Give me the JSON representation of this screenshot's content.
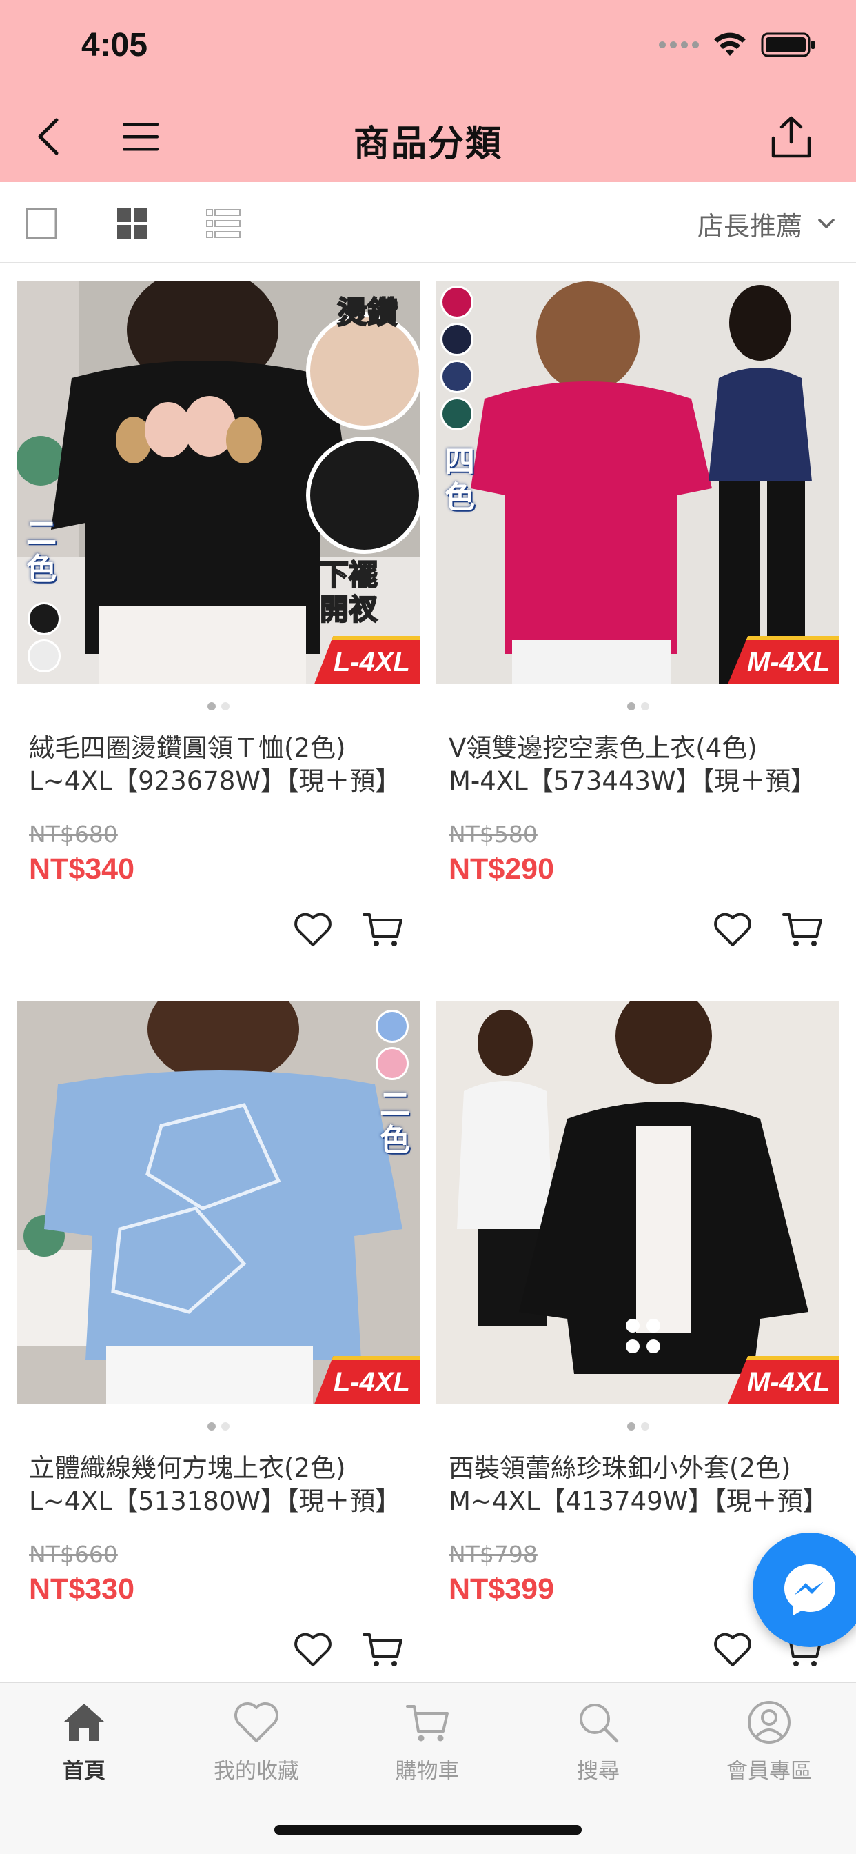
{
  "status_bar": {
    "time": "4:05"
  },
  "header": {
    "title": "商品分類"
  },
  "toolbar": {
    "sort_label": "店長推薦"
  },
  "products": [
    {
      "title_line1": "絨毛四圈燙鑽圓領Ｔ恤(2色)",
      "title_line2": "L~4XL【923678W】【現＋預】",
      "original_price": "NT$680",
      "sale_price": "NT$340",
      "size_badge": "L-4XL",
      "image_text_1": "燙鑽",
      "image_text_2": "下襬開衩",
      "image_color_label": "二色",
      "colors": [
        "#1a1a1a",
        "#ececec"
      ]
    },
    {
      "title_line1": "V領雙邊挖空素色上衣(4色)",
      "title_line2": "M-4XL【573443W】【現＋預】",
      "original_price": "NT$580",
      "sale_price": "NT$290",
      "size_badge": "M-4XL",
      "image_color_label": "四色",
      "colors": [
        "#c3124f",
        "#1c2340",
        "#2a3a6b",
        "#1f5a50"
      ]
    },
    {
      "title_line1": "立體織線幾何方塊上衣(2色)",
      "title_line2": "L~4XL【513180W】【現＋預】",
      "original_price": "NT$660",
      "sale_price": "NT$330",
      "size_badge": "L-4XL",
      "image_color_label": "二色",
      "colors": [
        "#8bb1e6",
        "#f2a9bd"
      ]
    },
    {
      "title_line1": "西裝領蕾絲珍珠釦小外套(2色)",
      "title_line2": "M~4XL【413749W】【現＋預】",
      "original_price": "NT$798",
      "sale_price": "NT$399",
      "size_badge": "M-4XL"
    }
  ],
  "tabbar": {
    "home": "首頁",
    "favorites": "我的收藏",
    "cart": "購物車",
    "search": "搜尋",
    "member": "會員專區"
  },
  "colors": {
    "header_bg": "#fdb8ba",
    "price": "#f0474a",
    "fab": "#1e8af7"
  }
}
